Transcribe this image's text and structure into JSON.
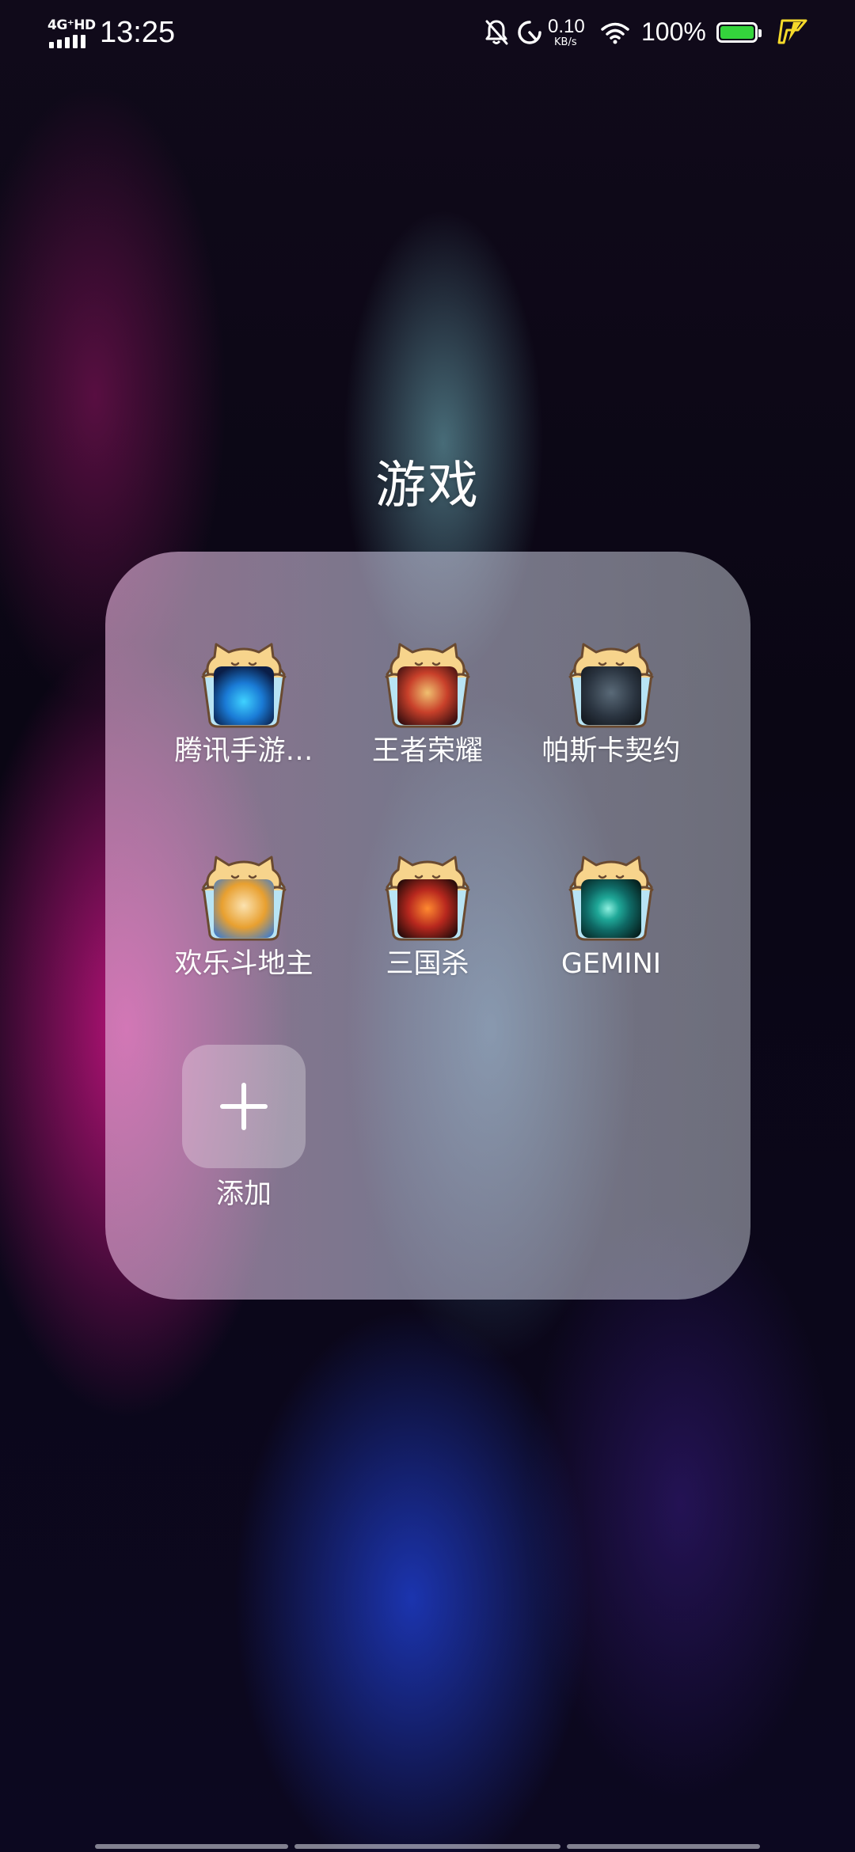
{
  "status_bar": {
    "network_label": "4G⁺HD",
    "time": "13:25",
    "net_speed_value": "0.10",
    "net_speed_unit": "KB/s",
    "battery_percent": "100%",
    "battery_level": 1.0,
    "battery_color": "#34d43c",
    "icons": [
      "signal-icon",
      "mute-bell-icon",
      "data-saver-icon",
      "wifi-icon",
      "battery-icon",
      "charging-bolt-icon"
    ]
  },
  "folder": {
    "title": "游戏",
    "apps": [
      {
        "label": "腾讯手游…",
        "icon": "tencent-mobile-games-icon",
        "color": "#1a7bd6"
      },
      {
        "label": "王者荣耀",
        "icon": "honor-of-kings-icon",
        "color": "#c8402a"
      },
      {
        "label": "帕斯卡契约",
        "icon": "pascal-contract-icon",
        "color": "#2a3440"
      },
      {
        "label": "欢乐斗地主",
        "icon": "happy-landlord-icon",
        "color": "#e8a030"
      },
      {
        "label": "三国杀",
        "icon": "sanguosha-icon",
        "color": "#b8281e"
      },
      {
        "label": "GEMINI",
        "icon": "gemini-icon",
        "color": "#0f6a66"
      }
    ],
    "add_label": "添加"
  }
}
